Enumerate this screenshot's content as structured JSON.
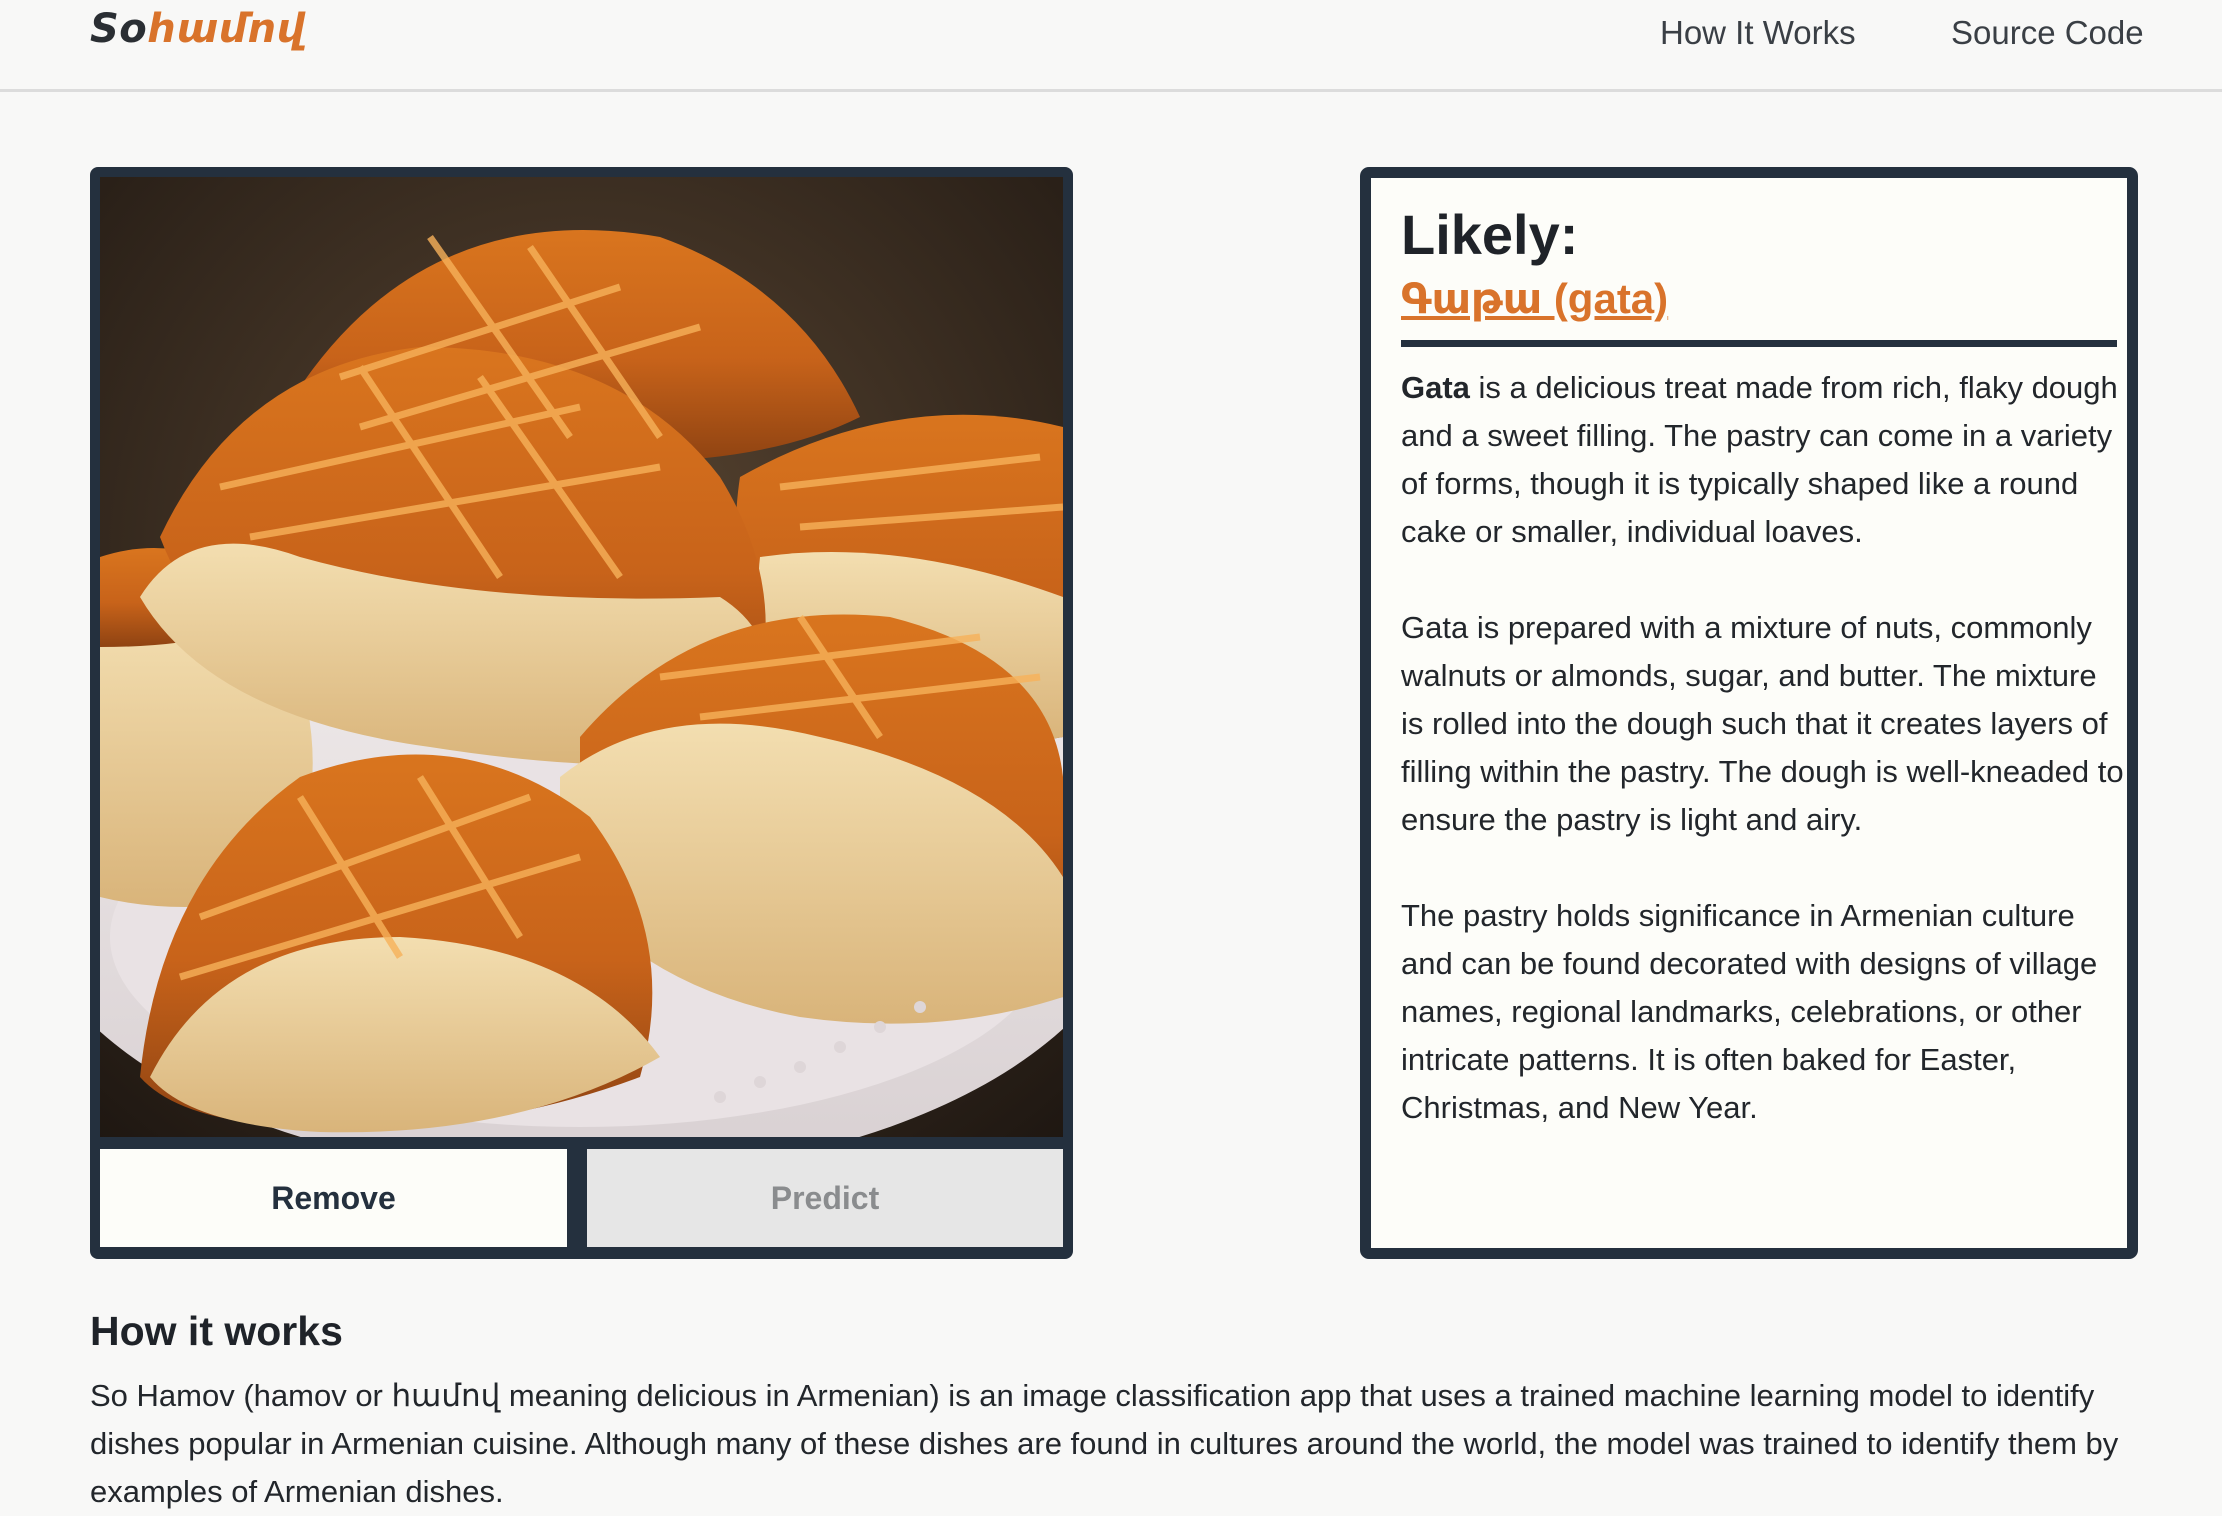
{
  "header": {
    "logo_part1": "So",
    "logo_part2": "համով",
    "nav": [
      "How It Works",
      "Source Code"
    ]
  },
  "image_card": {
    "image_alt": "Photo of gata pastries on a white plate",
    "remove_label": "Remove",
    "predict_label": "Predict"
  },
  "result": {
    "heading": "Likely:",
    "prediction": "Գաթա (gata)",
    "desc_lead": "Gata",
    "desc_p1_rest": " is a delicious treat made from rich, flaky dough and a sweet filling. The pastry can come in a variety of forms, though it is typically shaped like a round cake or smaller, individual loaves.",
    "desc_p2": "Gata is prepared with a mixture of nuts, commonly walnuts or almonds, sugar, and butter. The mixture is rolled into the dough such that it creates layers of filling within the pastry. The dough is well-kneaded to ensure the pastry is light and airy.",
    "desc_p3": "The pastry holds significance in Armenian culture and can be found decorated with designs of village names, regional landmarks, celebrations, or other intricate patterns. It is often baked for Easter, Christmas, and New Year."
  },
  "how_it_works": {
    "title": "How it works",
    "text": "So Hamov (hamov or համով meaning delicious in Armenian) is an image classification app that uses a trained machine learning model to identify dishes popular in Armenian cuisine. Although many of these dishes are found in cultures around the world, the model was trained to identify them by examples of Armenian dishes."
  },
  "colors": {
    "accent": "#d9732b",
    "dark": "#24303e",
    "background": "#f8f8f7",
    "card": "#fdfdf9"
  }
}
